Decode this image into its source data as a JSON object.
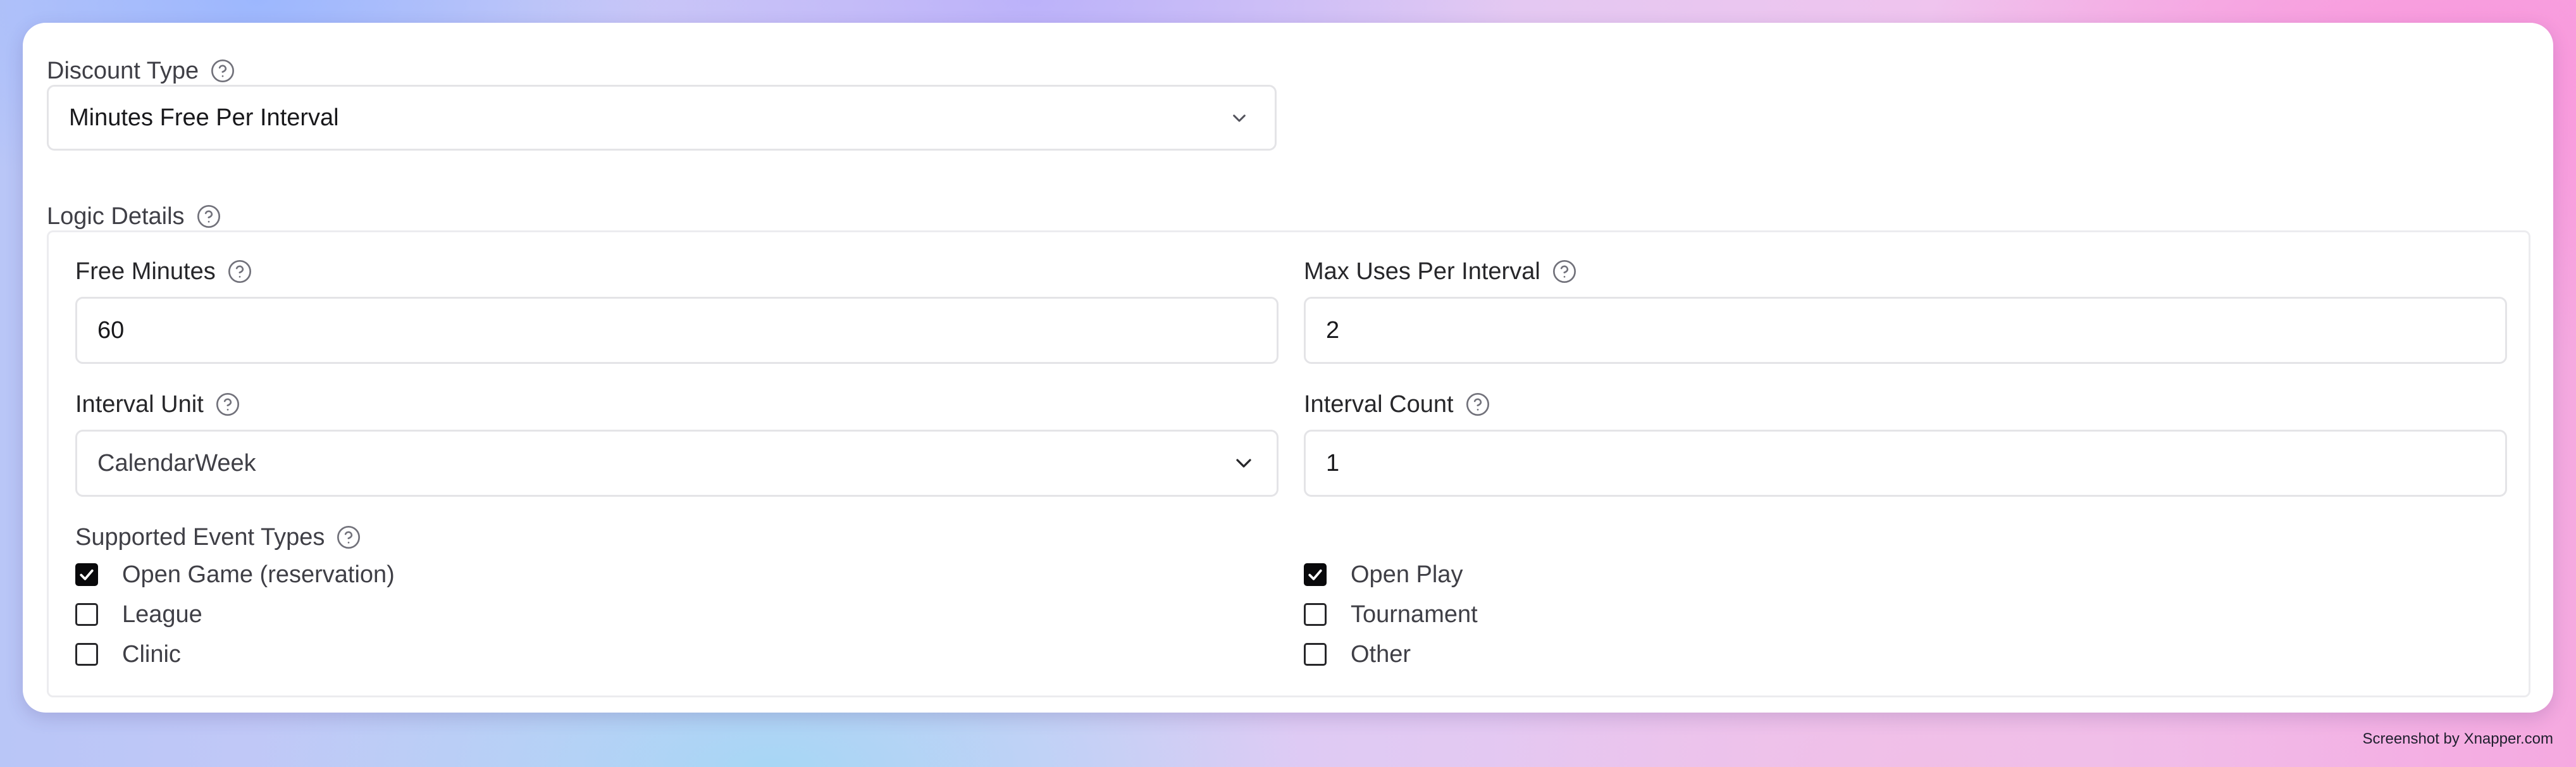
{
  "discount_type": {
    "label": "Discount Type",
    "selected": "Minutes Free Per Interval"
  },
  "logic_details": {
    "label": "Logic Details",
    "free_minutes": {
      "label": "Free Minutes",
      "value": "60"
    },
    "max_uses_per_interval": {
      "label": "Max Uses Per Interval",
      "value": "2"
    },
    "interval_unit": {
      "label": "Interval Unit",
      "selected": "CalendarWeek"
    },
    "interval_count": {
      "label": "Interval Count",
      "value": "1"
    },
    "supported_event_types": {
      "label": "Supported Event Types",
      "options": [
        {
          "label": "Open Game (reservation)",
          "checked": true
        },
        {
          "label": "Open Play",
          "checked": true
        },
        {
          "label": "League",
          "checked": false
        },
        {
          "label": "Tournament",
          "checked": false
        },
        {
          "label": "Clinic",
          "checked": false
        },
        {
          "label": "Other",
          "checked": false
        }
      ]
    }
  },
  "icons": {
    "help": "help-circle-icon",
    "chevron": "chevron-down-icon",
    "check": "check-icon"
  },
  "colors": {
    "checked_fill": "#09090b",
    "border": "#e4e4e7",
    "text": "#18181b"
  },
  "watermark": "Screenshot by Xnapper.com"
}
